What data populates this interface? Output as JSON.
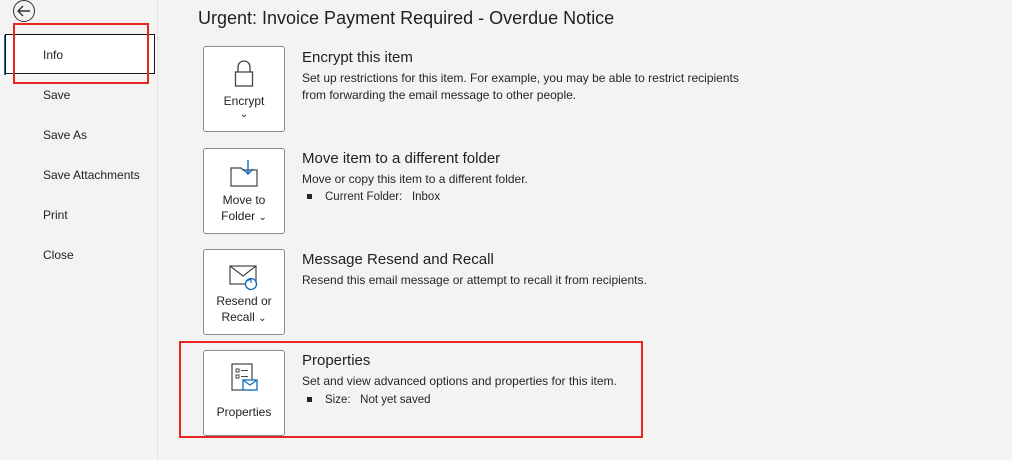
{
  "sidebar": {
    "items": [
      {
        "label": "Info",
        "active": true
      },
      {
        "label": "Save"
      },
      {
        "label": "Save As"
      },
      {
        "label": "Save Attachments"
      },
      {
        "label": "Print"
      },
      {
        "label": "Close"
      }
    ]
  },
  "main": {
    "title": "Urgent: Invoice Payment Required - Overdue Notice",
    "sections": [
      {
        "tile_label": "Encrypt",
        "heading": "Encrypt this item",
        "desc": "Set up restrictions for this item. For example, you may be able to restrict recipients from forwarding the email message to other people."
      },
      {
        "tile_label_1": "Move to",
        "tile_label_2": "Folder",
        "heading": "Move item to a different folder",
        "desc": "Move or copy this item to a different folder.",
        "bullet_label": "Current Folder:",
        "bullet_value": "Inbox"
      },
      {
        "tile_label_1": "Resend or",
        "tile_label_2": "Recall",
        "heading": "Message Resend and Recall",
        "desc": "Resend this email message or attempt to recall it from recipients."
      },
      {
        "tile_label": "Properties",
        "heading": "Properties",
        "desc": "Set and view advanced options and properties for this item.",
        "bullet_label": "Size:",
        "bullet_value": "Not yet saved"
      }
    ]
  },
  "colors": {
    "accent": "#0f6cbd",
    "highlight": "#e8251f"
  }
}
